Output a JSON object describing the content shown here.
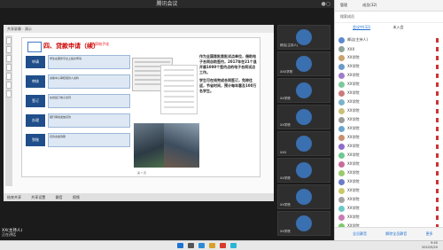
{
  "app": {
    "title": "腾讯会议",
    "right_status": "●○"
  },
  "share": {
    "toolbar": "共享屏幕 · 演示",
    "slide_title": "四、贷款申请（续）",
    "slide_tag": "合同电子化",
    "steps": [
      {
        "label": "申请",
        "text": "学生在服务平台上提交申请"
      },
      {
        "label": "审核",
        "text": "资助中心审核借款人资料"
      },
      {
        "label": "签订",
        "text": "在线签订电子合同"
      },
      {
        "label": "办理",
        "text": "银行审批发放贷款"
      },
      {
        "label": "到账",
        "text": "贷款资金到账"
      }
    ],
    "bullets": [
      "作为全国首批首批试点单位，借助电子合同自助签约，2017年在21个县开展1000个签约点的电子合同试点工作。",
      "学生可在线完成合同签订，免除往返，节省时间，预计每年惠及100万名学生。"
    ],
    "page": "第 7 页"
  },
  "shbar": {
    "items": [
      "结束共享",
      "共享设置",
      "静音",
      "视频"
    ]
  },
  "tiles": [
    {
      "name": "卿洁(主持人)"
    },
    {
      "name": "XXX学院"
    },
    {
      "name": "XX学院"
    },
    {
      "name": "XX学院"
    },
    {
      "name": "XXX"
    },
    {
      "name": "XX学院"
    },
    {
      "name": "XX学院"
    },
    {
      "name": "XX学院"
    }
  ],
  "panel": {
    "head": [
      "管理",
      "成员(32)"
    ],
    "sub": "搜索成员",
    "tabs": [
      "会议中(32)",
      "未入会"
    ],
    "members": [
      {
        "name": "卿洁(主持人)",
        "color": "#5b8ad1"
      },
      {
        "name": "XXX",
        "color": "#8fa39a"
      },
      {
        "name": "XX学院",
        "color": "#c9a36c"
      },
      {
        "name": "XX学院",
        "color": "#6c9bc9"
      },
      {
        "name": "XX学院",
        "color": "#a07bc9"
      },
      {
        "name": "XX学院",
        "color": "#7bc99b"
      },
      {
        "name": "XX学院",
        "color": "#c97b7b"
      },
      {
        "name": "XX学院",
        "color": "#7bb3c9"
      },
      {
        "name": "XX学院",
        "color": "#c9bf7b"
      },
      {
        "name": "XX学院",
        "color": "#9b9b9b"
      },
      {
        "name": "XX学院",
        "color": "#6ca6c9"
      },
      {
        "name": "XX学院",
        "color": "#c98f6c"
      },
      {
        "name": "XX学院",
        "color": "#8f6cc9"
      },
      {
        "name": "XX学院",
        "color": "#6cc98f"
      },
      {
        "name": "XX学院",
        "color": "#c96c9b"
      },
      {
        "name": "XX学院",
        "color": "#9bc96c"
      },
      {
        "name": "XX学院",
        "color": "#6c7bc9"
      },
      {
        "name": "XX学院",
        "color": "#c9c96c"
      },
      {
        "name": "XX学院",
        "color": "#a4a4a4"
      },
      {
        "name": "XX学院",
        "color": "#6cc9c9"
      },
      {
        "name": "XX学院",
        "color": "#c97bb3"
      },
      {
        "name": "XX学院",
        "color": "#7bc96c"
      }
    ],
    "footer": [
      "全员静音",
      "解除全员静音",
      "更多"
    ]
  },
  "bottom": {
    "name": "XX(主持人)",
    "sub": "正在讲话"
  },
  "taskbar": {
    "time": "9:45",
    "date": "2022/9/20"
  }
}
